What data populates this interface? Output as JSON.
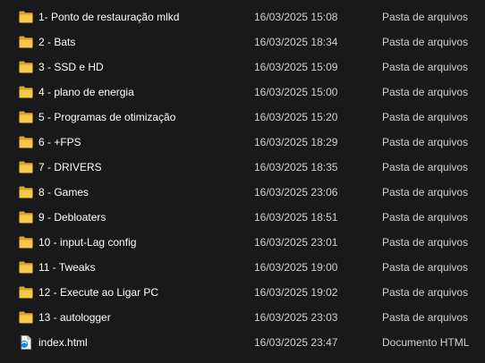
{
  "file_list": {
    "items": [
      {
        "name": "1- Ponto de restauração mlkd",
        "date": "16/03/2025 15:08",
        "type": "Pasta de arquivos",
        "icon": "folder-icon"
      },
      {
        "name": "2 - Bats",
        "date": "16/03/2025 18:34",
        "type": "Pasta de arquivos",
        "icon": "folder-icon"
      },
      {
        "name": "3 - SSD e HD",
        "date": "16/03/2025 15:09",
        "type": "Pasta de arquivos",
        "icon": "folder-icon"
      },
      {
        "name": "4 - plano de energia",
        "date": "16/03/2025 15:00",
        "type": "Pasta de arquivos",
        "icon": "folder-icon"
      },
      {
        "name": "5 - Programas de otimização",
        "date": "16/03/2025 15:20",
        "type": "Pasta de arquivos",
        "icon": "folder-icon"
      },
      {
        "name": "6 - +FPS",
        "date": "16/03/2025 18:29",
        "type": "Pasta de arquivos",
        "icon": "folder-icon"
      },
      {
        "name": "7 - DRIVERS",
        "date": "16/03/2025 18:35",
        "type": "Pasta de arquivos",
        "icon": "folder-icon"
      },
      {
        "name": "8 - Games",
        "date": "16/03/2025 23:06",
        "type": "Pasta de arquivos",
        "icon": "folder-icon"
      },
      {
        "name": "9 - Debloaters",
        "date": "16/03/2025 18:51",
        "type": "Pasta de arquivos",
        "icon": "folder-icon"
      },
      {
        "name": "10 - input-Lag config",
        "date": "16/03/2025 23:01",
        "type": "Pasta de arquivos",
        "icon": "folder-icon"
      },
      {
        "name": "11 - Tweaks",
        "date": "16/03/2025 19:00",
        "type": "Pasta de arquivos",
        "icon": "folder-icon"
      },
      {
        "name": "12 - Execute ao Ligar PC",
        "date": "16/03/2025 19:02",
        "type": "Pasta de arquivos",
        "icon": "folder-icon"
      },
      {
        "name": "13 - autologger",
        "date": "16/03/2025 23:03",
        "type": "Pasta de arquivos",
        "icon": "folder-icon"
      },
      {
        "name": "index.html",
        "date": "16/03/2025 23:47",
        "type": "Documento HTML",
        "icon": "html-file-icon"
      }
    ]
  },
  "colors": {
    "background": "#191919",
    "folder_front": "#f8c848",
    "folder_back": "#d9a22a",
    "text_primary": "#ffffff",
    "text_secondary": "#d0d0d0",
    "html_icon_accent": "#1e88e5"
  }
}
